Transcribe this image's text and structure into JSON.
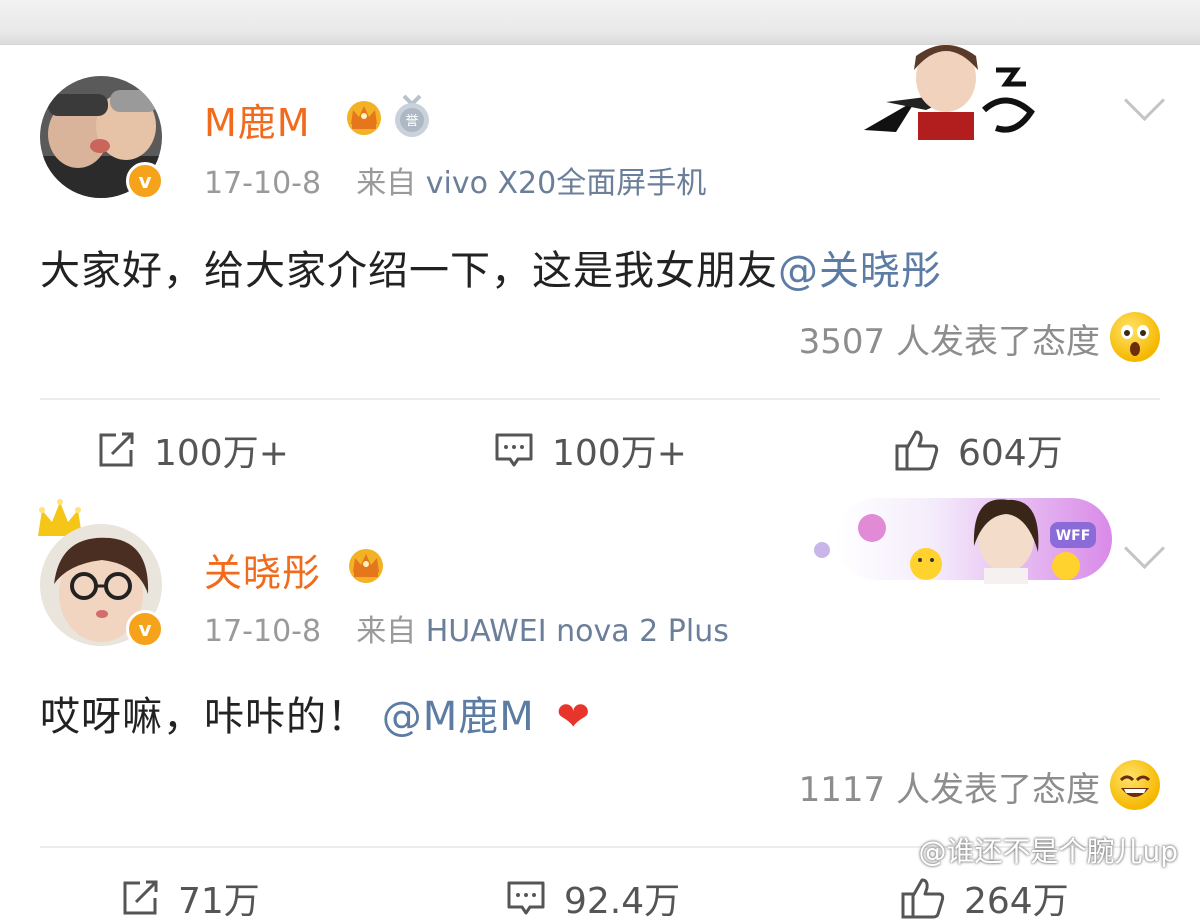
{
  "posts": [
    {
      "username": "M鹿M",
      "date": "17-10-8",
      "source_prefix": "来自",
      "source_device": "vivo X20全面屏手机",
      "text": "大家好，给大家介绍一下，这是我女朋友",
      "mention": "@关晓彤",
      "reactions_text": "3507 人发表了态度",
      "reaction_emoji": "surprised-emoji",
      "actions": {
        "repost": "100万+",
        "comment": "100万+",
        "like": "604万"
      }
    },
    {
      "username": "关晓彤",
      "date": "17-10-8",
      "source_prefix": "来自",
      "source_device": "HUAWEI nova 2 Plus",
      "text": "哎呀嘛，咔咔的！",
      "mention": "@M鹿M",
      "heart": "❤",
      "reactions_text": "1117 人发表了态度",
      "reaction_emoji": "grinning-emoji",
      "actions": {
        "repost": "71万",
        "comment": "92.4万",
        "like": "264万"
      }
    }
  ],
  "banner": {
    "badge_text": "WFF"
  },
  "watermark": "@谁还不是个腕儿up",
  "colors": {
    "username": "#f26b1d",
    "mention": "#5c7ca3",
    "vip_badge": "#f7a21b",
    "heart": "#e8352c"
  }
}
